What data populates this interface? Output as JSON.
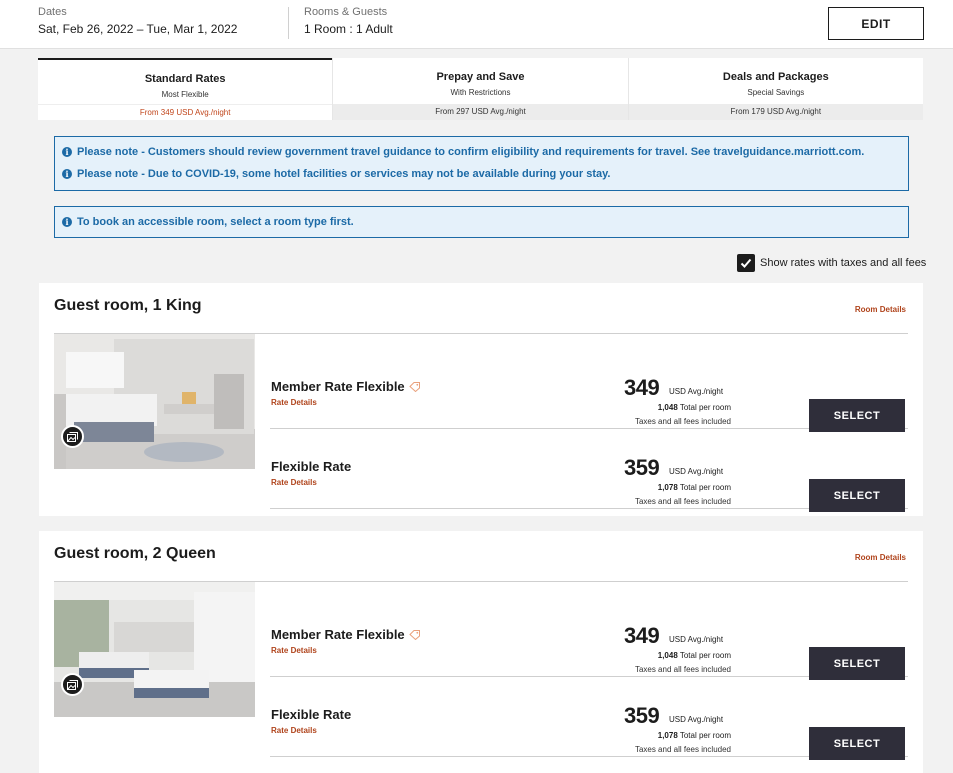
{
  "header": {
    "dates_label": "Dates",
    "dates_value": "Sat, Feb 26, 2022 – Tue, Mar 1, 2022",
    "guests_label": "Rooms & Guests",
    "guests_value": "1 Room : 1 Adult",
    "edit_label": "EDIT"
  },
  "tabs": [
    {
      "title": "Standard Rates",
      "subtitle": "Most Flexible",
      "price": "From 349 USD Avg./night",
      "active": true
    },
    {
      "title": "Prepay and Save",
      "subtitle": "With Restrictions",
      "price": "From 297 USD Avg./night",
      "active": false
    },
    {
      "title": "Deals and Packages",
      "subtitle": "Special Savings",
      "price": "From 179 USD Avg./night",
      "active": false
    }
  ],
  "alerts": {
    "notice1": "Please note - Customers should review government travel guidance to confirm eligibility and requirements for travel. See travelguidance.marriott.com.",
    "notice2": "Please note - Due to COVID-19, some hotel facilities or services may not be available during your stay.",
    "accessible": "To book an accessible room, select a room type first."
  },
  "tax_toggle": {
    "label": "Show rates with taxes and all fees",
    "checked": true
  },
  "rooms": [
    {
      "title": "Guest room, 1 King",
      "details_label": "Room Details",
      "rates": [
        {
          "name": "Member Rate Flexible",
          "details_label": "Rate Details",
          "price": "349",
          "unit": "USD Avg./night",
          "total_num": "1,048",
          "total_label": "Total per room",
          "tax_note": "Taxes and all fees included",
          "select_label": "SELECT"
        },
        {
          "name": "Flexible Rate",
          "details_label": "Rate Details",
          "price": "359",
          "unit": "USD Avg./night",
          "total_num": "1,078",
          "total_label": "Total per room",
          "tax_note": "Taxes and all fees included",
          "select_label": "SELECT"
        }
      ]
    },
    {
      "title": "Guest room, 2 Queen",
      "details_label": "Room Details",
      "rates": [
        {
          "name": "Member Rate Flexible",
          "details_label": "Rate Details",
          "price": "349",
          "unit": "USD Avg./night",
          "total_num": "1,048",
          "total_label": "Total per room",
          "tax_note": "Taxes and all fees included",
          "select_label": "SELECT"
        },
        {
          "name": "Flexible Rate",
          "details_label": "Rate Details",
          "price": "359",
          "unit": "USD Avg./night",
          "total_num": "1,078",
          "total_label": "Total per room",
          "tax_note": "Taxes and all fees included",
          "select_label": "SELECT"
        }
      ]
    }
  ],
  "colors": {
    "accent": "#b0441c",
    "info": "#1c6aa6",
    "button_dark": "#2f2e3a"
  }
}
